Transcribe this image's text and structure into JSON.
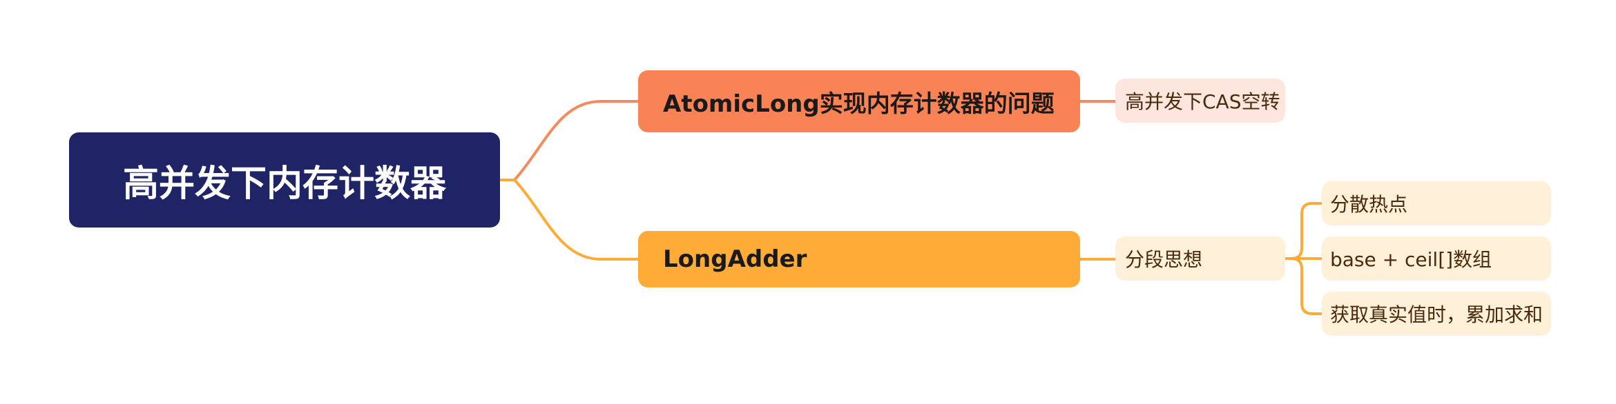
{
  "root": {
    "label": "高并发下内存计数器"
  },
  "branches": [
    {
      "label": "AtomicLong实现内存计数器的问题",
      "children": [
        {
          "label": "高并发下CAS空转"
        }
      ]
    },
    {
      "label": "LongAdder",
      "children": [
        {
          "label": "分段思想",
          "children": [
            {
              "label": "分散热点"
            },
            {
              "label": "base + ceil[]数组"
            },
            {
              "label": "获取真实值时，累加求和"
            }
          ]
        }
      ]
    }
  ],
  "colors": {
    "root": "#1f2466",
    "branch_1": "#fa8356",
    "branch_2": "#ffab38",
    "leaf_1": "#fde6dd",
    "leaf_2": "#fff0d9",
    "connector_1": "#f58a5e",
    "connector_2": "#ffab38"
  }
}
